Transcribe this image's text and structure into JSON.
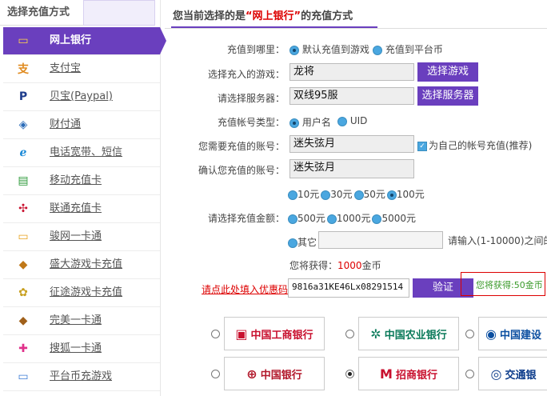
{
  "sidebar": {
    "title": "选择充值方式",
    "items": [
      {
        "label": "网上银行",
        "icon": "bank-card-icon",
        "active": true
      },
      {
        "label": "支付宝",
        "icon": "alipay-icon"
      },
      {
        "label": "贝宝(Paypal)",
        "icon": "paypal-icon"
      },
      {
        "label": "财付通",
        "icon": "tenpay-shield-icon"
      },
      {
        "label": "电话宽带、短信",
        "icon": "telecom-icon"
      },
      {
        "label": "移动充值卡",
        "icon": "mobile-card-icon"
      },
      {
        "label": "联通充值卡",
        "icon": "unicom-icon"
      },
      {
        "label": "骏网一卡通",
        "icon": "card-icon"
      },
      {
        "label": "盛大游戏卡充值",
        "icon": "shanda-icon"
      },
      {
        "label": "征途游戏卡充值",
        "icon": "zhengtu-icon"
      },
      {
        "label": "完美一卡通",
        "icon": "perfect-world-icon"
      },
      {
        "label": "搜狐一卡通",
        "icon": "sohu-icon"
      },
      {
        "label": "平台币充游戏",
        "icon": "platform-coin-icon"
      }
    ]
  },
  "header": {
    "prefix": "您当前选择的是",
    "highlight": "“网上银行”",
    "suffix": "的充值方式"
  },
  "form": {
    "target_label": "充值到哪里：",
    "target_opt1": "默认充值到游戏",
    "target_opt2": "充值到平台币",
    "game_label": "选择充入的游戏：",
    "game_value": "龙将",
    "game_button": "选择游戏",
    "server_label": "请选择服务器：",
    "server_value": "双线95服",
    "server_button": "选择服务器",
    "account_type_label": "充值帐号类型：",
    "account_type_opt1": "用户名",
    "account_type_opt2": "UID",
    "account_label": "您需要充值的账号：",
    "account_value": "迷失弦月",
    "self_charge_label": "为自己的帐号充值(推荐)",
    "confirm_label": "确认您充值的账号：",
    "confirm_value": "迷失弦月",
    "amount_label": "请选择充值金额：",
    "amounts_row1": [
      "10元",
      "30元",
      "50元",
      "100元"
    ],
    "amounts_row2": [
      "500元",
      "1000元",
      "5000元"
    ],
    "amount_other": "其它",
    "amount_hint": "请输入(1-10000)之间的",
    "receive_prefix": "您将获得：",
    "receive_amount": "1000",
    "receive_suffix": "金币",
    "coupon_link": "请点此处填入优惠码",
    "coupon_value": "9816a31KE46Lx08291514",
    "verify_button": "验证",
    "coupon_result": "您将获得:50金币"
  },
  "banks": [
    {
      "name": "中国工商银行",
      "icon": "icbc-logo-icon"
    },
    {
      "name": "中国农业银行",
      "icon": "abc-logo-icon"
    },
    {
      "name": "中国建设",
      "icon": "ccb-logo-icon"
    },
    {
      "name": "中国银行",
      "icon": "boc-logo-icon"
    },
    {
      "name": "招商银行",
      "icon": "cmb-logo-icon",
      "selected": true
    },
    {
      "name": "交通银",
      "icon": "bocom-logo-icon"
    }
  ],
  "colors": {
    "accent": "#6a3fbe",
    "highlight": "#dd0000",
    "radio": "#4aa7e0"
  }
}
